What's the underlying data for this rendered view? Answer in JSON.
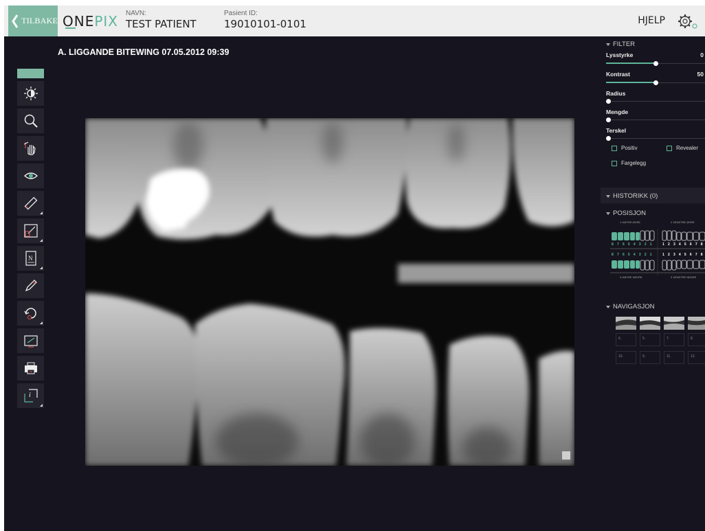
{
  "header": {
    "back_label": "TILBAKE",
    "logo_one": "ONE",
    "logo_pix": "PIX",
    "name_caption": "NAVN:",
    "name_value": "TEST PATIENT",
    "id_caption": "Pasient ID:",
    "id_value": "19010101-0101",
    "help_label": "HJELP"
  },
  "image_title": "A. LIGGANDE BITEWING 07.05.2012 09:39",
  "toolbar": {
    "icons": [
      "brightness-icon",
      "zoom-icon",
      "pan-icon",
      "visibility-icon",
      "measure-icon",
      "calibrate-icon",
      "annotation-icon",
      "draw-icon",
      "rotate-icon",
      "export-icon",
      "print-icon",
      "info-icon"
    ]
  },
  "filter": {
    "header": "FILTER",
    "brightness": {
      "label": "Lysstyrke",
      "value": "0",
      "level": 0.5
    },
    "contrast": {
      "label": "Kontrast",
      "value": "50",
      "level": 0.5
    },
    "radius": {
      "label": "Radius",
      "level": 0
    },
    "amount": {
      "label": "Mengde",
      "level": 0
    },
    "threshold": {
      "label": "Terskel",
      "level": 0
    },
    "positive_label": "Positiv",
    "reveal_label": "Revealer",
    "colorize_label": "Fargelegg"
  },
  "history": {
    "header": "HISTORIKK (0)"
  },
  "position": {
    "header": "POSISJON",
    "upper_right": "1 HØYRE ØVRE",
    "upper_left": "2 VENSTRE ØVRE",
    "lower_right": "4 HØYRE NEDRE",
    "lower_left": "3 VENSTRE NEDRE",
    "right_numbers": "8 7 6 5 4 3 2 1",
    "left_numbers": "1 2 3 4 5 6 7 8"
  },
  "navigation": {
    "header": "NAVIGASJON",
    "slots": [
      "6.",
      "5.",
      "7.",
      "8.",
      "10.",
      "9.",
      "11.",
      "12."
    ]
  },
  "colors": {
    "accent": "#7fb9a4",
    "teal": "#5fb59a",
    "background": "#16151f"
  }
}
